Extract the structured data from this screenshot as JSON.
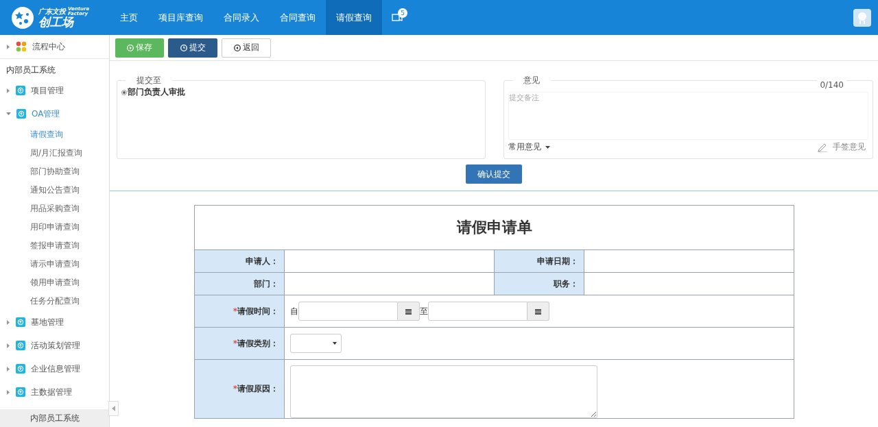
{
  "header": {
    "logo": {
      "small_text": "广东文投",
      "tag_text": "Venture Factory",
      "big_text": "创工场"
    },
    "nav": [
      {
        "label": "主页",
        "selected": false
      },
      {
        "label": "项目库查询",
        "selected": false
      },
      {
        "label": "合同录入",
        "selected": false
      },
      {
        "label": "合同查询",
        "selected": false
      },
      {
        "label": "请假查询",
        "selected": true
      }
    ],
    "notifications": {
      "badge": "5"
    }
  },
  "sidebar": {
    "top_item": "流程中心",
    "section_title": "内部员工系统",
    "groups": [
      {
        "label": "项目管理",
        "expanded": false
      },
      {
        "label": "OA管理",
        "expanded": true,
        "children": [
          {
            "label": "请假查询",
            "selected": true
          },
          {
            "label": "周/月汇报查询",
            "selected": false
          },
          {
            "label": "部门协助查询",
            "selected": false
          },
          {
            "label": "通知公告查询",
            "selected": false
          },
          {
            "label": "用品采购查询",
            "selected": false
          },
          {
            "label": "用印申请查询",
            "selected": false
          },
          {
            "label": "签报申请查询",
            "selected": false
          },
          {
            "label": "请示申请查询",
            "selected": false
          },
          {
            "label": "领用申请查询",
            "selected": false
          },
          {
            "label": "任务分配查询",
            "selected": false
          }
        ]
      },
      {
        "label": "基地管理",
        "expanded": false
      },
      {
        "label": "活动策划管理",
        "expanded": false
      },
      {
        "label": "企业信息管理",
        "expanded": false
      },
      {
        "label": "主数据管理",
        "expanded": false
      }
    ],
    "footer": "内部员工系统"
  },
  "toolbar": {
    "buttons": [
      {
        "label": "保存",
        "kind": "save"
      },
      {
        "label": "提交",
        "kind": "submit"
      },
      {
        "label": "返回",
        "kind": "back"
      }
    ]
  },
  "submit_panel": {
    "legend": "提交至",
    "options": [
      {
        "label": "部门负责人审批",
        "selected": true
      }
    ]
  },
  "opinion_panel": {
    "legend": "意见",
    "counter": "0/140",
    "placeholder": "提交备注",
    "common_opinions": "常用意见",
    "signature": "手签意见"
  },
  "confirm_button": "确认提交",
  "form": {
    "title": "请假申请单",
    "rows": [
      {
        "kind": "pair",
        "cells": [
          {
            "label": "申请人："
          },
          {
            "label": "申请日期："
          }
        ]
      },
      {
        "kind": "pair",
        "cells": [
          {
            "label": "部门："
          },
          {
            "label": "职务："
          }
        ]
      },
      {
        "kind": "daterange",
        "label": "请假时间：",
        "required_mark": "*",
        "from": "自",
        "to": "至"
      },
      {
        "kind": "select",
        "label": "请假类别：",
        "required_mark": "*"
      },
      {
        "kind": "textarea",
        "label": "请假原因：",
        "required_mark": "*"
      }
    ]
  }
}
